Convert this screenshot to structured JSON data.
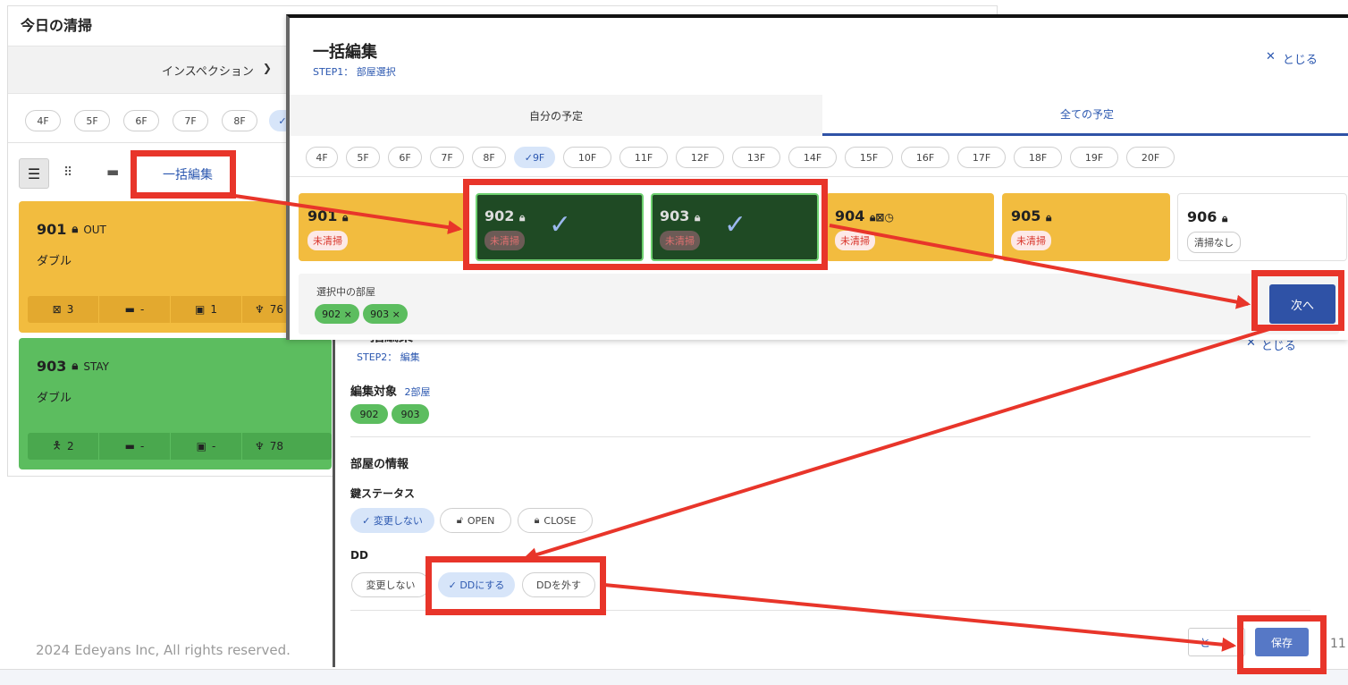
{
  "bg": {
    "title": "今日の清掃",
    "inspection_label": "インスペクション",
    "floors": [
      "4F",
      "5F",
      "6F",
      "7F",
      "8F"
    ],
    "bulk_edit_label": "一括編集",
    "rooms": [
      {
        "number": "901",
        "status": "OUT",
        "type": "ダブル",
        "stats": [
          "3",
          "-",
          "1",
          "76"
        ]
      },
      {
        "number": "903",
        "status": "STAY",
        "type": "ダブル",
        "stats": [
          "2",
          "-",
          "-",
          "78"
        ]
      }
    ],
    "footer": "2024 Edeyans Inc,   All rights reserved."
  },
  "step1": {
    "title": "一括編集",
    "step": "STEP1： 部屋選択",
    "close": "とじる",
    "tabs": [
      "自分の予定",
      "全ての予定"
    ],
    "floors": [
      "4F",
      "5F",
      "6F",
      "7F",
      "8F",
      "9F",
      "10F",
      "11F",
      "12F",
      "13F",
      "14F",
      "15F",
      "16F",
      "17F",
      "18F",
      "19F",
      "20F"
    ],
    "selected_floor": "9F",
    "rooms": [
      {
        "number": "901",
        "badge": "未清掃"
      },
      {
        "number": "902",
        "badge": "未清掃"
      },
      {
        "number": "903",
        "badge": "未清掃"
      },
      {
        "number": "904",
        "badge": "未清掃"
      },
      {
        "number": "905",
        "badge": "未清掃"
      },
      {
        "number": "906",
        "badge": "清掃なし"
      }
    ],
    "selected_label": "選択中の部屋",
    "selected_chips": [
      "902 ×",
      "903 ×"
    ],
    "next": "次へ"
  },
  "step2": {
    "title_partial": "一括編集",
    "step": "STEP2： 編集",
    "close": "とじる",
    "target_label": "編集対象",
    "target_count": "2部屋",
    "target_chips": [
      "902",
      "903"
    ],
    "section": "部屋の情報",
    "key_status_label": "鍵ステータス",
    "key_options": [
      "✓ 変更しない",
      "OPEN",
      "CLOSE"
    ],
    "dd_label": "DD",
    "dd_options": [
      "変更しない",
      "✓ DDにする",
      "DDを外す"
    ],
    "save": "保存",
    "cancel_partial": "と",
    "page_num": "11"
  },
  "colors": {
    "yellow": "#f2bc3f",
    "green": "#5cbd5f",
    "dark_green": "#1f4a24",
    "blue": "#2f52a6",
    "red": "#e8352a"
  }
}
